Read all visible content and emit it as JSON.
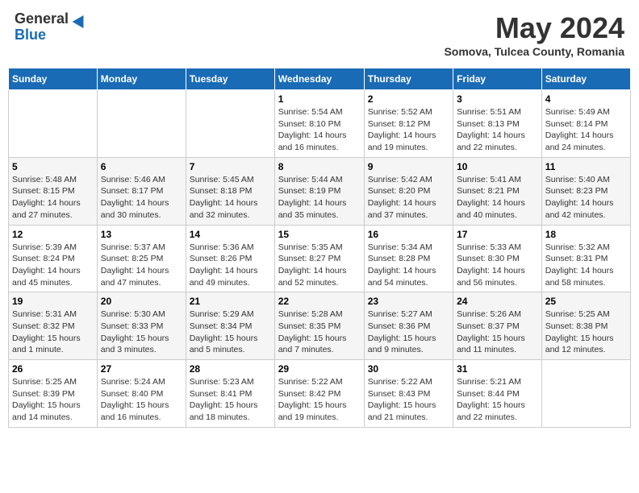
{
  "logo": {
    "general": "General",
    "blue": "Blue"
  },
  "title": "May 2024",
  "subtitle": "Somova, Tulcea County, Romania",
  "headers": [
    "Sunday",
    "Monday",
    "Tuesday",
    "Wednesday",
    "Thursday",
    "Friday",
    "Saturday"
  ],
  "weeks": [
    [
      {
        "day": "",
        "info": ""
      },
      {
        "day": "",
        "info": ""
      },
      {
        "day": "",
        "info": ""
      },
      {
        "day": "1",
        "info": "Sunrise: 5:54 AM\nSunset: 8:10 PM\nDaylight: 14 hours and 16 minutes."
      },
      {
        "day": "2",
        "info": "Sunrise: 5:52 AM\nSunset: 8:12 PM\nDaylight: 14 hours and 19 minutes."
      },
      {
        "day": "3",
        "info": "Sunrise: 5:51 AM\nSunset: 8:13 PM\nDaylight: 14 hours and 22 minutes."
      },
      {
        "day": "4",
        "info": "Sunrise: 5:49 AM\nSunset: 8:14 PM\nDaylight: 14 hours and 24 minutes."
      }
    ],
    [
      {
        "day": "5",
        "info": "Sunrise: 5:48 AM\nSunset: 8:15 PM\nDaylight: 14 hours and 27 minutes."
      },
      {
        "day": "6",
        "info": "Sunrise: 5:46 AM\nSunset: 8:17 PM\nDaylight: 14 hours and 30 minutes."
      },
      {
        "day": "7",
        "info": "Sunrise: 5:45 AM\nSunset: 8:18 PM\nDaylight: 14 hours and 32 minutes."
      },
      {
        "day": "8",
        "info": "Sunrise: 5:44 AM\nSunset: 8:19 PM\nDaylight: 14 hours and 35 minutes."
      },
      {
        "day": "9",
        "info": "Sunrise: 5:42 AM\nSunset: 8:20 PM\nDaylight: 14 hours and 37 minutes."
      },
      {
        "day": "10",
        "info": "Sunrise: 5:41 AM\nSunset: 8:21 PM\nDaylight: 14 hours and 40 minutes."
      },
      {
        "day": "11",
        "info": "Sunrise: 5:40 AM\nSunset: 8:23 PM\nDaylight: 14 hours and 42 minutes."
      }
    ],
    [
      {
        "day": "12",
        "info": "Sunrise: 5:39 AM\nSunset: 8:24 PM\nDaylight: 14 hours and 45 minutes."
      },
      {
        "day": "13",
        "info": "Sunrise: 5:37 AM\nSunset: 8:25 PM\nDaylight: 14 hours and 47 minutes."
      },
      {
        "day": "14",
        "info": "Sunrise: 5:36 AM\nSunset: 8:26 PM\nDaylight: 14 hours and 49 minutes."
      },
      {
        "day": "15",
        "info": "Sunrise: 5:35 AM\nSunset: 8:27 PM\nDaylight: 14 hours and 52 minutes."
      },
      {
        "day": "16",
        "info": "Sunrise: 5:34 AM\nSunset: 8:28 PM\nDaylight: 14 hours and 54 minutes."
      },
      {
        "day": "17",
        "info": "Sunrise: 5:33 AM\nSunset: 8:30 PM\nDaylight: 14 hours and 56 minutes."
      },
      {
        "day": "18",
        "info": "Sunrise: 5:32 AM\nSunset: 8:31 PM\nDaylight: 14 hours and 58 minutes."
      }
    ],
    [
      {
        "day": "19",
        "info": "Sunrise: 5:31 AM\nSunset: 8:32 PM\nDaylight: 15 hours and 1 minute."
      },
      {
        "day": "20",
        "info": "Sunrise: 5:30 AM\nSunset: 8:33 PM\nDaylight: 15 hours and 3 minutes."
      },
      {
        "day": "21",
        "info": "Sunrise: 5:29 AM\nSunset: 8:34 PM\nDaylight: 15 hours and 5 minutes."
      },
      {
        "day": "22",
        "info": "Sunrise: 5:28 AM\nSunset: 8:35 PM\nDaylight: 15 hours and 7 minutes."
      },
      {
        "day": "23",
        "info": "Sunrise: 5:27 AM\nSunset: 8:36 PM\nDaylight: 15 hours and 9 minutes."
      },
      {
        "day": "24",
        "info": "Sunrise: 5:26 AM\nSunset: 8:37 PM\nDaylight: 15 hours and 11 minutes."
      },
      {
        "day": "25",
        "info": "Sunrise: 5:25 AM\nSunset: 8:38 PM\nDaylight: 15 hours and 12 minutes."
      }
    ],
    [
      {
        "day": "26",
        "info": "Sunrise: 5:25 AM\nSunset: 8:39 PM\nDaylight: 15 hours and 14 minutes."
      },
      {
        "day": "27",
        "info": "Sunrise: 5:24 AM\nSunset: 8:40 PM\nDaylight: 15 hours and 16 minutes."
      },
      {
        "day": "28",
        "info": "Sunrise: 5:23 AM\nSunset: 8:41 PM\nDaylight: 15 hours and 18 minutes."
      },
      {
        "day": "29",
        "info": "Sunrise: 5:22 AM\nSunset: 8:42 PM\nDaylight: 15 hours and 19 minutes."
      },
      {
        "day": "30",
        "info": "Sunrise: 5:22 AM\nSunset: 8:43 PM\nDaylight: 15 hours and 21 minutes."
      },
      {
        "day": "31",
        "info": "Sunrise: 5:21 AM\nSunset: 8:44 PM\nDaylight: 15 hours and 22 minutes."
      },
      {
        "day": "",
        "info": ""
      }
    ]
  ]
}
